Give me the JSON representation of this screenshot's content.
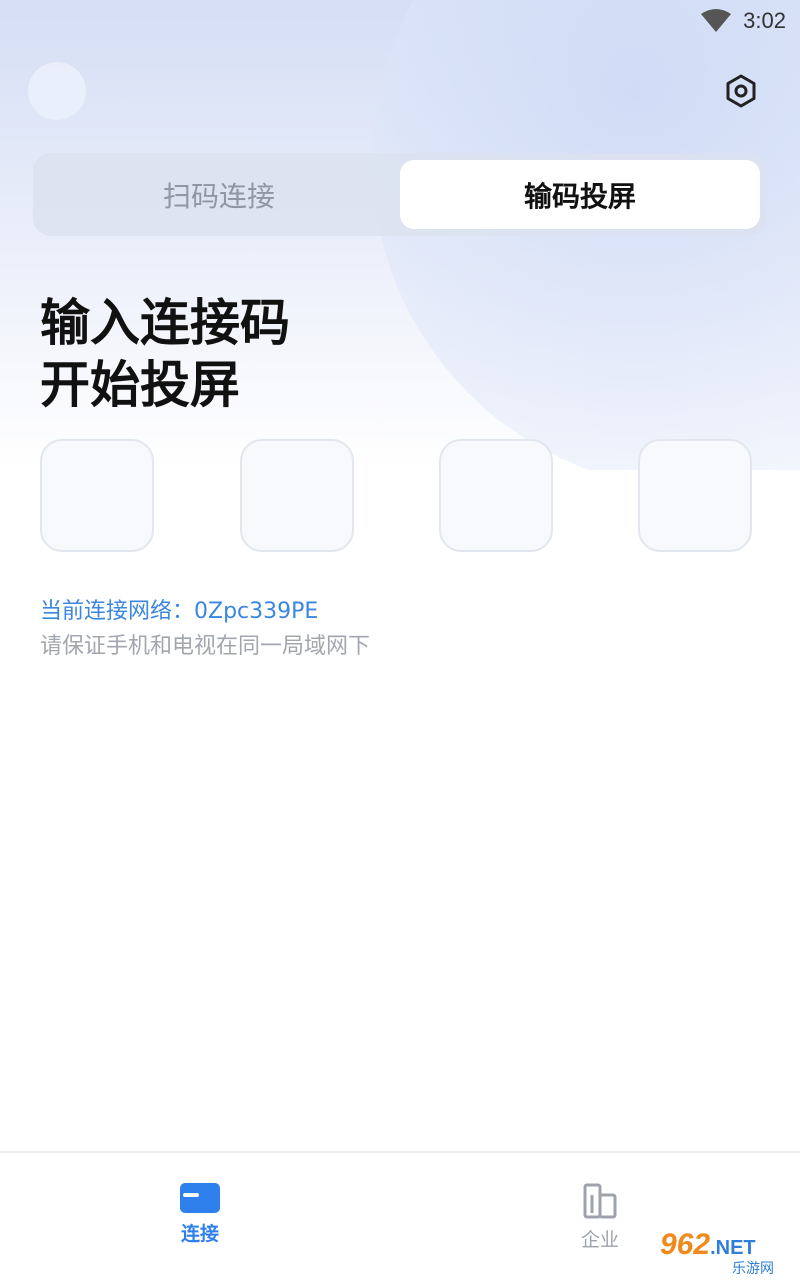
{
  "status_bar": {
    "time": "3:02",
    "wifi_icon": "wifi-icon"
  },
  "header": {
    "settings_icon": "gear-icon"
  },
  "tabs": [
    {
      "label": "扫码连接",
      "active": false
    },
    {
      "label": "输码投屏",
      "active": true
    }
  ],
  "headline": {
    "line1": "输入连接码",
    "line2": "开始投屏"
  },
  "code_inputs": [
    "",
    "",
    "",
    ""
  ],
  "network": {
    "text": "当前连接网络：0Zpc339PE"
  },
  "hint": "请保证手机和电视在同一局域网下",
  "bottom_nav": [
    {
      "label": "连接",
      "icon": "screen-icon",
      "active": true
    },
    {
      "label": "企业",
      "icon": "building-icon",
      "active": false
    }
  ],
  "watermark": {
    "main": "962",
    "suffix": ".NET",
    "sub": "乐游网"
  },
  "colors": {
    "accent": "#2f80ed",
    "network_text": "#3a86e0",
    "hint_text": "#a2a6ae"
  }
}
